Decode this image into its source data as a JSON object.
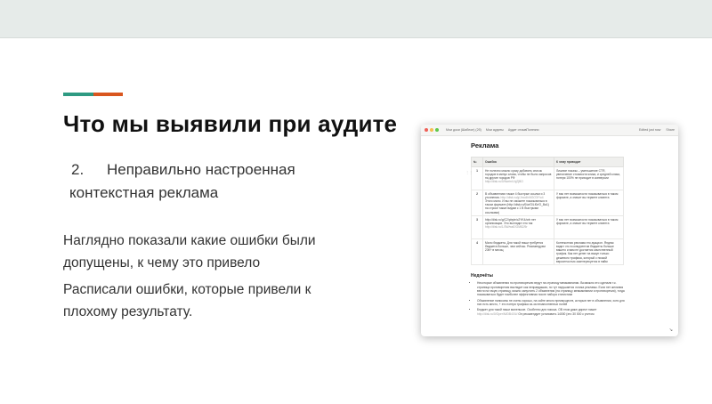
{
  "slide": {
    "title": "Что мы выявили при аудите",
    "point_number": "2.",
    "point_text": "Неправильно настроенная контекстная реклама",
    "para1": "Наглядно показали какие ошибки были допущены, к чему это привело",
    "para2": "Расписали ошибки, которые привели к плохому результату.",
    "accent_colors": [
      "#2e9a82",
      "#d9561f"
    ]
  },
  "screenshot": {
    "breadcrumbs": [
      "Мои доки (Шаблон) (2б)",
      "Мои аудиты",
      "Аудит отзывПолезни"
    ],
    "edited": "Edited just now",
    "share": "Share",
    "doc_title": "Реклама",
    "table": {
      "headers": [
        "№",
        "Ошибка",
        "К чему приводит"
      ],
      "rows": [
        {
          "n": "1",
          "error": "Не полезно можно сразу добавить список городов в минус слова, чтобы не было запросов на другие городов РФ",
          "error_link": "http://disk.ru/0/Nw/m/Lfg7jBO",
          "result": "Лишние показы – уменьшение CTR, увеличение стоимости клика, и средней клика, потеря 100% не приходит в конверсии"
        },
        {
          "n": "2",
          "error": "В объявлениях также 4 быстрые ссылки и 3 уточнения.",
          "error_link": "http://disk.ru/g/Jmo4h/6GO3Y/o4",
          "error_tail": "Этого мало. И вы не сможете показываться в таком формате (http://disk.ru/0/w/O/Lf0r/O_Ba1) на строке также видим с 1 В быстрыми ссылками)",
          "result": "У вас нет возможности показываться в таком формате, а значит вы теряете клиента"
        },
        {
          "n": "3",
          "error": "http://disk.ru/g/C2/pbyte/c2YK4/orb нет организации. Это выглядит это так",
          "error_link": "http://disk.ru/1/3W/wsE/GM82/5r",
          "result": "У вас нет возможности показываться в таком формате, а значит вы теряете клиента"
        },
        {
          "n": "4",
          "error": "Мало бюджета. Для такой ниши требуется бюджета больше, чем сейчас. Рекомендуем 23К+ в месяц",
          "error_link": "",
          "result": "Контекстная реклама это аукцион. Яндекс видит что в конкурентов бюджеты больше вашего и вам не достается качественный трафик. Как нет денег на выкуп только дешевого трафика, который с низкой вероятностью заинтересуется в найм"
        }
      ]
    },
    "shortcomings_title": "Недочёты",
    "bullets": [
      "Некоторые объявления по противоречию ведут на страницу мемкампании. Возможно это сделали т.к. страница противоречия выглядит как неправдашая, но тут нарушается логика рекламы. Если нет желания вести на такую страницу, можно запустить 2 объявления (на страницу мемкампании и противоречия), тогда показываться будет наиболее эффективная после набора статистики",
      "Объявление написаны не очень хорошо, на сайте много преимуществ, которые нет в объявлении, хотя для них есть место, + это потеря трафика из-за незаполненных полей",
      "Бюджет для такой ниши маленькое. Особенно для поиска. ОВ этом даже директ пишет"
    ],
    "bullet_link": "http://disk.ru/0/Oper/M/DB4/0Lf",
    "bullet_tail": "Он рекомендует установить 14000 (это 30 000 с учетом"
  }
}
